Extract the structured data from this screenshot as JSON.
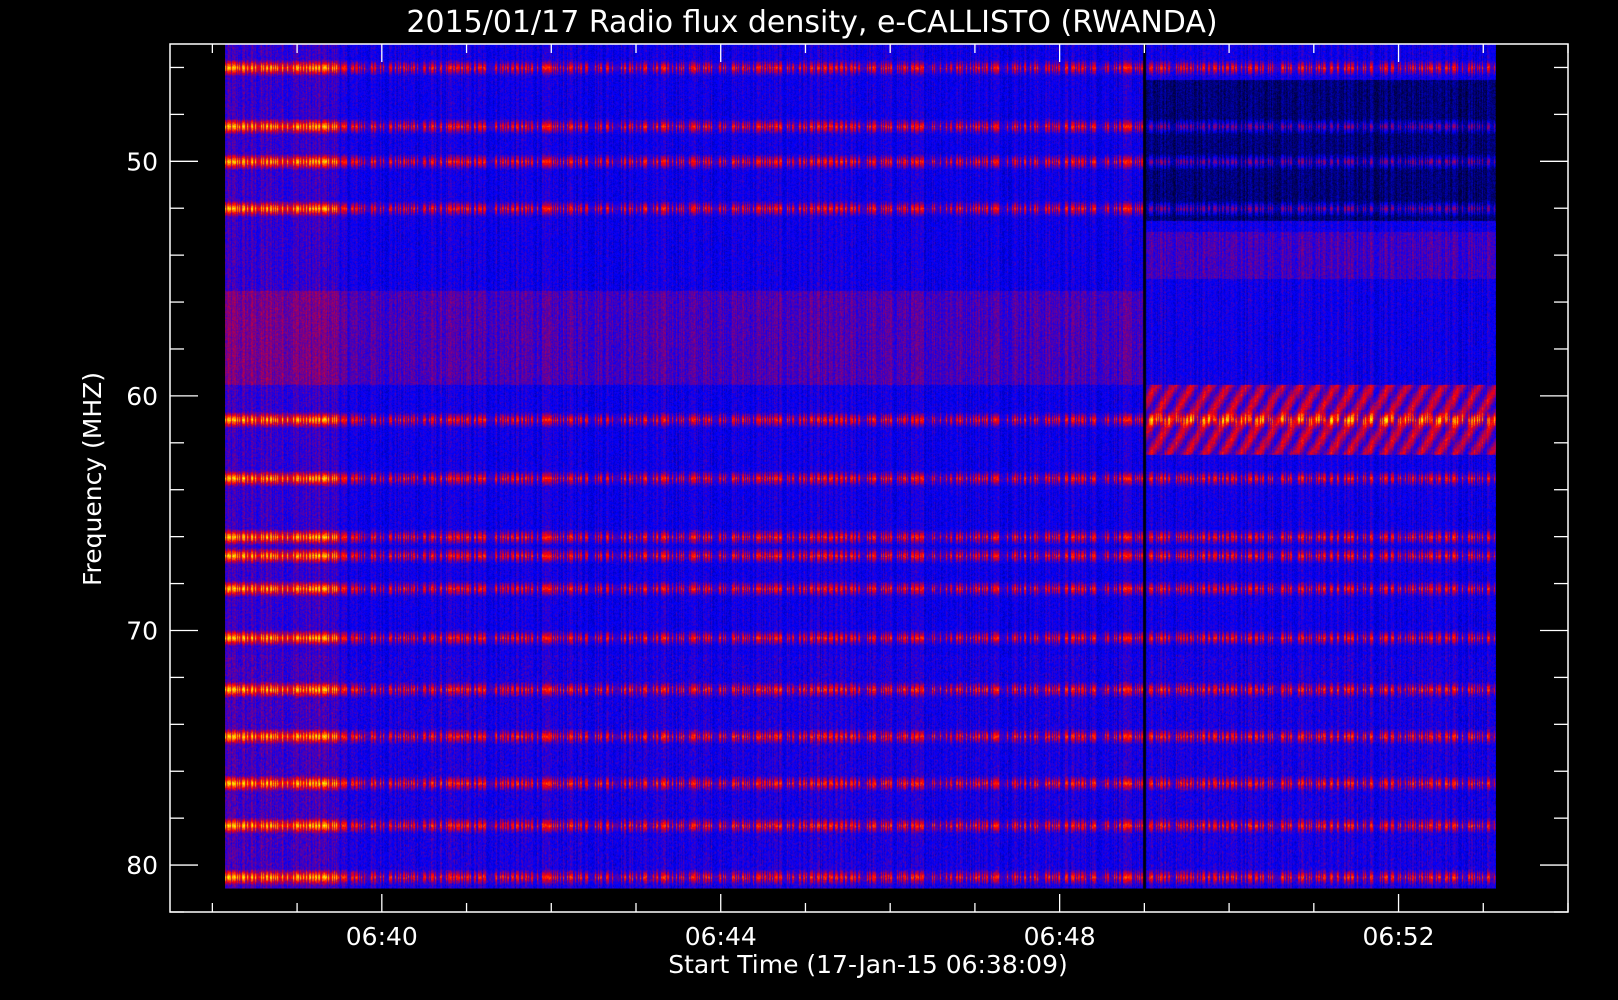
{
  "chart_data": {
    "type": "heatmap",
    "title": "2015/01/17  Radio flux density, e-CALLISTO (RWANDA)",
    "xlabel": "Start Time (17-Jan-15 06:38:09)",
    "ylabel": "Frequency (MHZ)",
    "x_ticks": [
      "06:40",
      "06:44",
      "06:48",
      "06:52"
    ],
    "x_tick_minutes": [
      40,
      44,
      48,
      52
    ],
    "y_ticks": [
      50,
      60,
      70,
      80
    ],
    "xlim": [
      "06:37:30",
      "06:54:00"
    ],
    "ylim": [
      45,
      82
    ],
    "y_axis_inverted": true,
    "data_extent": {
      "time_start": "06:38:09",
      "time_end": "06:53:09",
      "freq_min": 45,
      "freq_max": 81
    },
    "colormap": [
      "#000000",
      "#0000ff",
      "#ff0000",
      "#ffff00"
    ],
    "grid": false
  }
}
